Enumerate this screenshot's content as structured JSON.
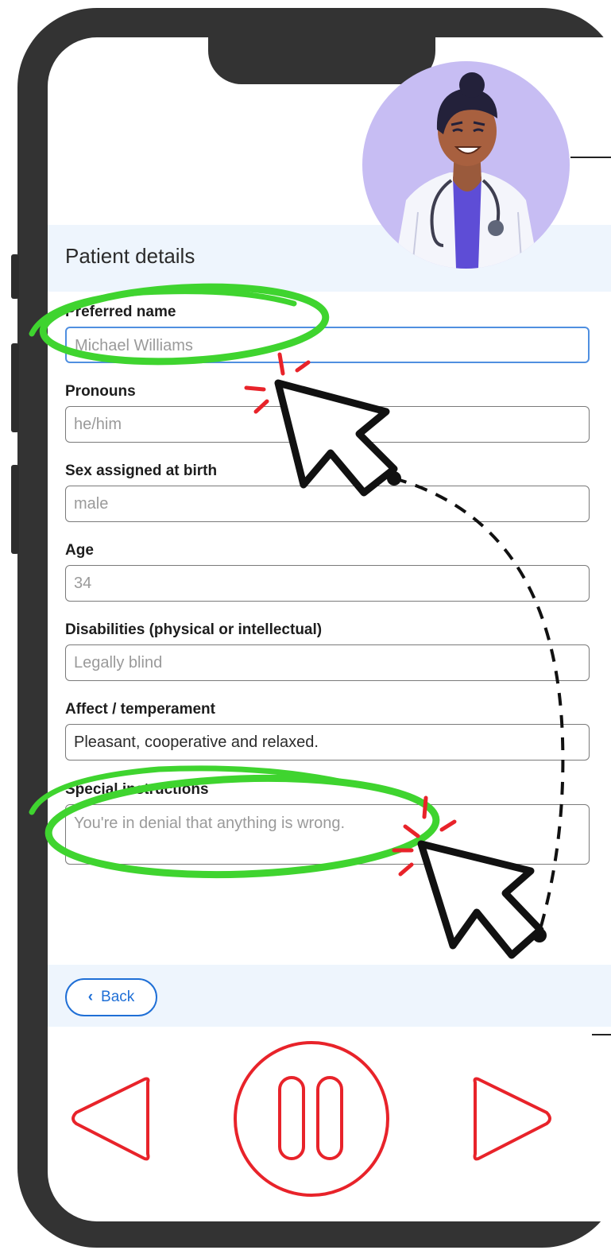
{
  "form": {
    "title": "Patient details",
    "fields": [
      {
        "label": "Preferred name",
        "value": "Michael Williams"
      },
      {
        "label": "Pronouns",
        "value": "he/him"
      },
      {
        "label": "Sex assigned at birth",
        "value": "male"
      },
      {
        "label": "Age",
        "value": "34"
      },
      {
        "label": "Disabilities (physical or intellectual)",
        "value": "Legally blind"
      },
      {
        "label": "Affect / temperament",
        "value": "Pleasant, cooperative and relaxed."
      },
      {
        "label": "Special instructions",
        "value": "You're in denial that anything is wrong."
      }
    ]
  },
  "footer": {
    "back_label": "Back"
  },
  "media_controls": {
    "icons": [
      "previous-icon",
      "pause-icon",
      "next-icon"
    ],
    "color": "#e8232a"
  },
  "colors": {
    "accent": "#1f6fd6",
    "highlight": "#3fd42f",
    "annotation": "#e8232a",
    "band": "#eef5fd"
  }
}
